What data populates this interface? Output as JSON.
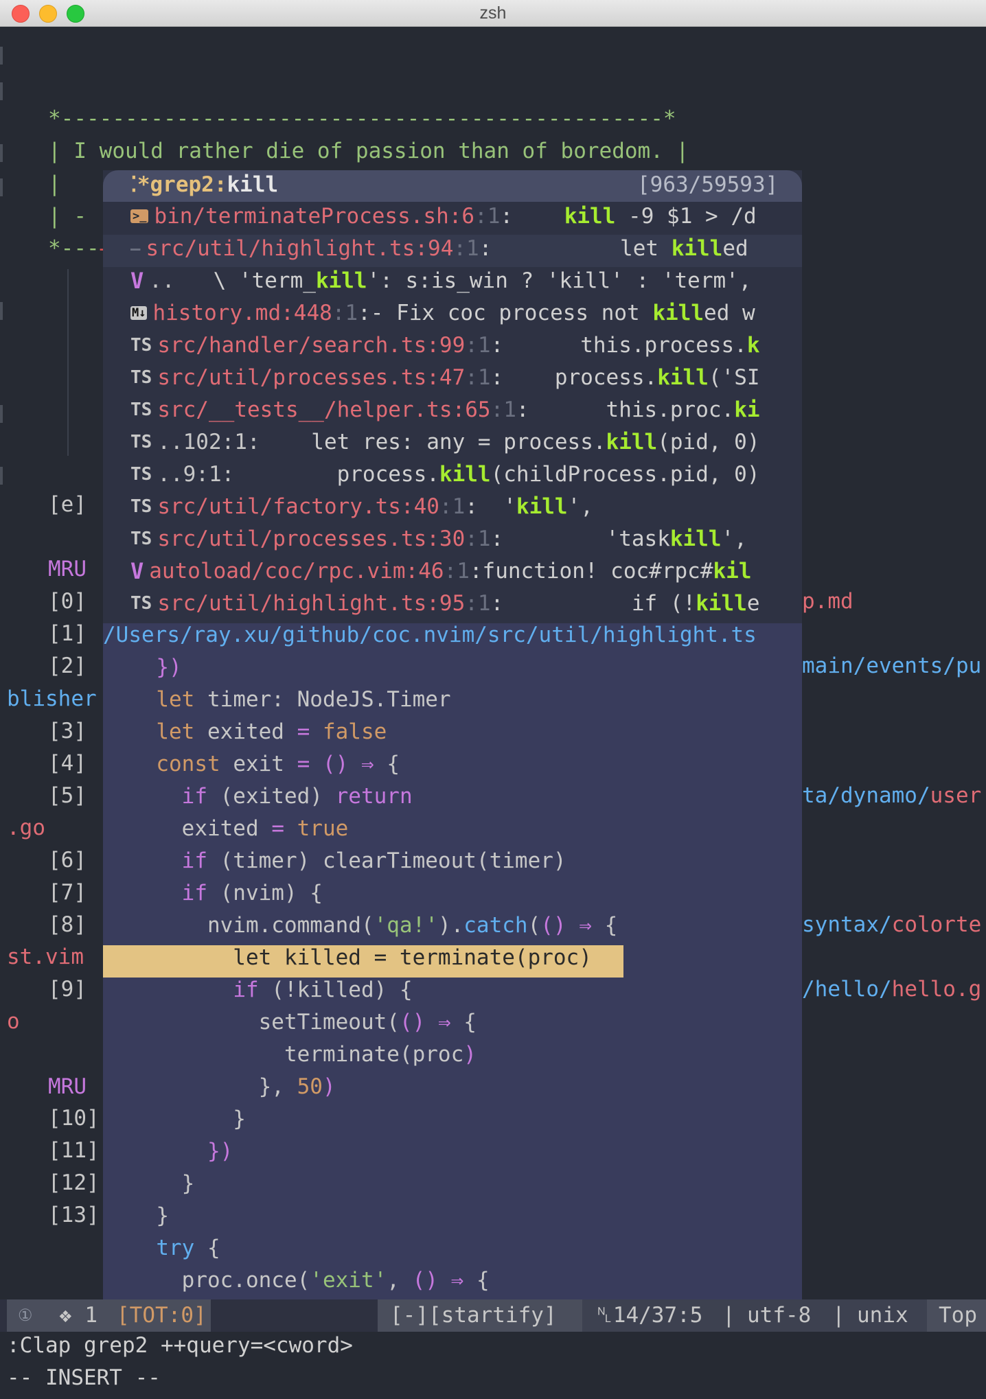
{
  "window": {
    "title": "zsh"
  },
  "banner": {
    "border": "*-----------------------------------------------*",
    "quote": "| I would rather die of passion than of boredom. |",
    "pipe": "|",
    "dash_line": "| -",
    "arrow_line": "*---→"
  },
  "startify": {
    "items": [
      {
        "label": "[e]"
      },
      {
        "label": "MRU"
      },
      {
        "label": "[0]",
        "tail": "p.md"
      },
      {
        "label": "[1]"
      },
      {
        "label": "[2]",
        "tail_a": "main/events/pu"
      },
      {
        "wrap": "blisher"
      },
      {
        "label": "[3]"
      },
      {
        "label": "[4]"
      },
      {
        "label": "[5]",
        "tail_a": "ta/dynamo/",
        "tail_b": "user"
      },
      {
        "wrap": ".go"
      },
      {
        "label": "[6]"
      },
      {
        "label": "[7]"
      },
      {
        "label": "[8]",
        "tail_a": "syntax/",
        "tail_b": "colorte"
      },
      {
        "wrap": "st.vim"
      },
      {
        "label": "[9]",
        "tail_a": "/hello/",
        "tail_b": "hello.g"
      },
      {
        "wrap": "o"
      },
      {
        "label": "MRU"
      },
      {
        "label": "[10]"
      },
      {
        "label": "[11]"
      },
      {
        "label": "[12]"
      },
      {
        "label": "[13]"
      }
    ]
  },
  "picker": {
    "title_prefix": "⁚*grep2:",
    "title_query": "kill",
    "count": "[963/59593]",
    "results": [
      {
        "icon": "sh",
        "icon_text": ">_",
        "path": "bin/terminateProcess.sh",
        "loc": ":6",
        "col": ":1",
        "sep": ":",
        "pre": "    ",
        "match": "kill",
        "post": " -9 $1 > /d"
      },
      {
        "icon": "dash",
        "icon_text": "—",
        "path": "src/util/highlight.ts",
        "loc": ":94",
        "col": ":1",
        "sep": ":",
        "pre": "          let ",
        "match": "kill",
        "post": "ed"
      },
      {
        "icon": "vim",
        "icon_text": "V",
        "path": "",
        "loc": "..",
        "col": "",
        "sep": "",
        "pre": "   \\ 'term_",
        "match": "kill",
        "post": "': s:is_win ? 'kill' : 'term',"
      },
      {
        "icon": "md",
        "icon_text": "M↓",
        "path": "history.md",
        "loc": ":448",
        "col": ":1",
        "sep": ":",
        "pre": "- Fix coc process not ",
        "match": "kill",
        "post": "ed w"
      },
      {
        "icon": "ts",
        "icon_text": "TS",
        "path": "src/handler/search.ts",
        "loc": ":99",
        "col": ":1",
        "sep": ":",
        "pre": "      this.process.",
        "match": "k",
        "post": ""
      },
      {
        "icon": "ts",
        "icon_text": "TS",
        "path": "src/util/processes.ts",
        "loc": ":47",
        "col": ":1",
        "sep": ":",
        "pre": "    process.",
        "match": "kill",
        "post": "('SI"
      },
      {
        "icon": "ts",
        "icon_text": "TS",
        "path": "src/__tests__/helper.ts",
        "loc": ":65",
        "col": ":1",
        "sep": ":",
        "pre": "      this.proc.",
        "match": "ki",
        "post": ""
      },
      {
        "icon": "ts",
        "icon_text": "TS",
        "path": "",
        "loc": "..102:1:",
        "col": "",
        "sep": "",
        "pre": "    let res: any = process.",
        "match": "kill",
        "post": "(pid, 0)"
      },
      {
        "icon": "ts",
        "icon_text": "TS",
        "path": "",
        "loc": "..9:1:",
        "col": "",
        "sep": "",
        "pre": "        process.",
        "match": "kill",
        "post": "(childProcess.pid, 0)"
      },
      {
        "icon": "ts",
        "icon_text": "TS",
        "path": "src/util/factory.ts",
        "loc": ":40",
        "col": ":1",
        "sep": ":",
        "pre": "  '",
        "match": "kill",
        "post": "',"
      },
      {
        "icon": "ts",
        "icon_text": "TS",
        "path": "src/util/processes.ts",
        "loc": ":30",
        "col": ":1",
        "sep": ":",
        "pre": "        'task",
        "match": "kill",
        "post": "',"
      },
      {
        "icon": "vim",
        "icon_text": "V",
        "path": "autoload/coc/rpc.vim",
        "loc": ":46",
        "col": ":1",
        "sep": ":",
        "pre": "function! coc#rpc#",
        "match": "kil",
        "post": ""
      },
      {
        "icon": "ts",
        "icon_text": "TS",
        "path": "src/util/highlight.ts",
        "loc": ":95",
        "col": ":1",
        "sep": ":",
        "pre": "          if (!",
        "match": "kill",
        "post": "e"
      }
    ]
  },
  "preview": {
    "path": "/Users/ray.xu/github/coc.nvim/src/util/highlight.ts",
    "lines": [
      [
        {
          "t": "  "
        },
        {
          "t": "})",
          "c": "purple"
        }
      ],
      [
        {
          "t": "  "
        },
        {
          "t": "let",
          "c": "orange"
        },
        {
          "t": " timer: NodeJS.Timer"
        }
      ],
      [
        {
          "t": "  "
        },
        {
          "t": "let",
          "c": "orange"
        },
        {
          "t": " exited "
        },
        {
          "t": "=",
          "c": "purple"
        },
        {
          "t": " "
        },
        {
          "t": "false",
          "c": "orange"
        }
      ],
      [
        {
          "t": "  "
        },
        {
          "t": "const",
          "c": "orange"
        },
        {
          "t": " exit "
        },
        {
          "t": "=",
          "c": "purple"
        },
        {
          "t": " "
        },
        {
          "t": "()",
          "c": "purple"
        },
        {
          "t": " "
        },
        {
          "t": "⇒",
          "c": "purple"
        },
        {
          "t": " {"
        }
      ],
      [
        {
          "t": "    "
        },
        {
          "t": "if",
          "c": "purple"
        },
        {
          "t": " (exited) "
        },
        {
          "t": "return",
          "c": "purple"
        }
      ],
      [
        {
          "t": "    exited "
        },
        {
          "t": "=",
          "c": "purple"
        },
        {
          "t": " "
        },
        {
          "t": "true",
          "c": "orange"
        }
      ],
      [
        {
          "t": "    "
        },
        {
          "t": "if",
          "c": "purple"
        },
        {
          "t": " (timer) clearTimeout(timer)"
        }
      ],
      [
        {
          "t": "    "
        },
        {
          "t": "if",
          "c": "purple"
        },
        {
          "t": " (nvim) {"
        }
      ],
      [
        {
          "t": "      nvim.command("
        },
        {
          "t": "'qa!'",
          "c": "green"
        },
        {
          "t": ")."
        },
        {
          "t": "catch",
          "c": "blue"
        },
        {
          "t": "("
        },
        {
          "t": "()",
          "c": "purple"
        },
        {
          "t": " "
        },
        {
          "t": "⇒",
          "c": "purple"
        },
        {
          "t": " {"
        }
      ],
      [
        {
          "t": "        let killed = terminate(proc)",
          "c": "dark"
        }
      ],
      [
        {
          "t": "        "
        },
        {
          "t": "if",
          "c": "purple"
        },
        {
          "t": " (!killed) {"
        }
      ],
      [
        {
          "t": "          setTimeout("
        },
        {
          "t": "()",
          "c": "purple"
        },
        {
          "t": " "
        },
        {
          "t": "⇒",
          "c": "purple"
        },
        {
          "t": " {"
        }
      ],
      [
        {
          "t": "            terminate(proc"
        },
        {
          "t": ")",
          "c": "purple"
        }
      ],
      [
        {
          "t": "          }, "
        },
        {
          "t": "50",
          "c": "orange"
        },
        {
          "t": ")",
          "c": "purple"
        }
      ],
      [
        {
          "t": "        }"
        }
      ],
      [
        {
          "t": "      })",
          "c": "mix"
        }
      ],
      [
        {
          "t": "    }"
        }
      ],
      [
        {
          "t": "  }"
        }
      ],
      [
        {
          "t": "  "
        },
        {
          "t": "try",
          "c": "blue"
        },
        {
          "t": " {"
        }
      ],
      [
        {
          "t": "    proc.once("
        },
        {
          "t": "'exit'",
          "c": "green"
        },
        {
          "t": ", "
        },
        {
          "t": "()",
          "c": "purple"
        },
        {
          "t": " "
        },
        {
          "t": "⇒",
          "c": "purple"
        },
        {
          "t": " {"
        }
      ]
    ]
  },
  "statusline": {
    "buffer_icon": "①",
    "mode": "❖ 1",
    "tot": "[TOT:0]",
    "file": "[-][startify]",
    "position": "␤14/37:5",
    "encoding": "utf-8",
    "format": "unix",
    "scroll": "Top",
    "separator": "|"
  },
  "cmdline": {
    "command": ":Clap grep2 ++query=<cword>",
    "mode": "-- INSERT --"
  },
  "colors": {
    "background": "#262a33",
    "picker_bg": "#2e3243",
    "preview_bg": "#393c5c",
    "highlight_line": "#e3c383",
    "match": "#a6ec30",
    "path": "#e06c75"
  }
}
